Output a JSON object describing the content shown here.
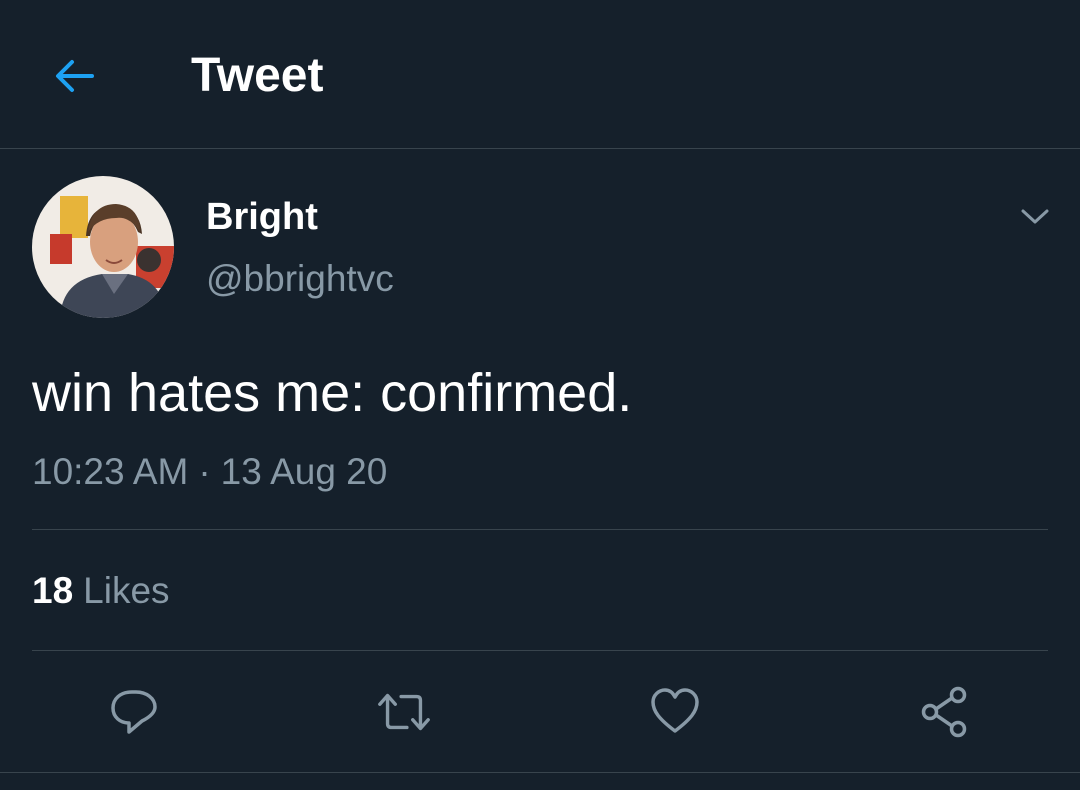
{
  "header": {
    "title": "Tweet",
    "back_icon": "arrow-left-icon"
  },
  "colors": {
    "background": "#15202b",
    "accent": "#1da1f2",
    "secondary_text": "#8899a6",
    "divider": "#38444d"
  },
  "author": {
    "display_name": "Bright",
    "handle": "@bbrightvc",
    "avatar_icon": "profile-photo"
  },
  "tweet": {
    "text": "win hates me: confirmed.",
    "time": "10:23 AM",
    "separator": "·",
    "date": "13 Aug 20"
  },
  "stats": {
    "likes_count": "18",
    "likes_label": "Likes"
  },
  "actions": {
    "reply_icon": "reply-bubble-icon",
    "retweet_icon": "retweet-icon",
    "like_icon": "heart-icon",
    "share_icon": "share-icon"
  }
}
